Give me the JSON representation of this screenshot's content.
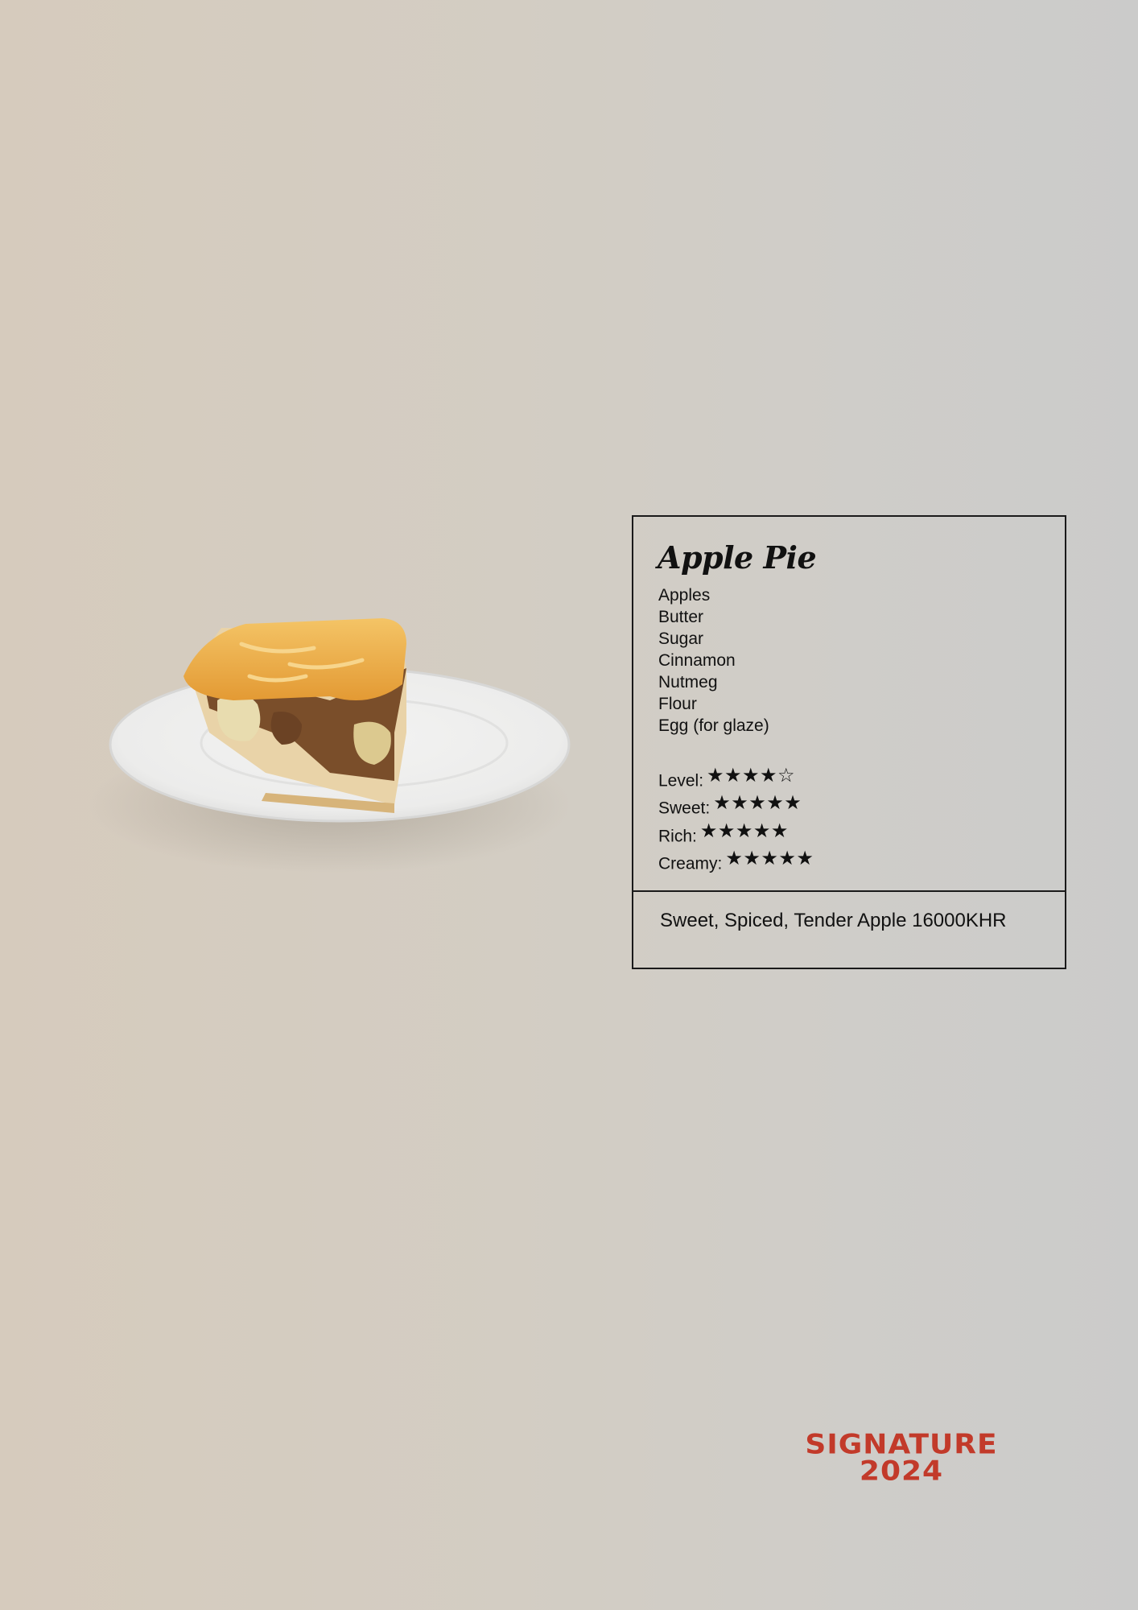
{
  "item": {
    "name": "Apple Pie",
    "ingredients": [
      "Apples",
      "Butter",
      "Sugar",
      "Cinnamon",
      "Nutmeg",
      "Flour",
      "Egg (for glaze)"
    ],
    "ratings": [
      {
        "label": "Level:",
        "stars": 4,
        "max": 5
      },
      {
        "label": "Sweet:",
        "stars": 5,
        "max": 5
      },
      {
        "label": "Rich:",
        "stars": 5,
        "max": 5
      },
      {
        "label": "Creamy:",
        "stars": 5,
        "max": 5
      }
    ],
    "tagline": "Sweet, Spiced, Tender Apple 16000KHR"
  },
  "image": {
    "subject": "pie-slice-on-plate-icon"
  },
  "logo": {
    "line1": "SIGNATURE",
    "line2": "2024",
    "color": "#c23a2a"
  },
  "colors": {
    "border": "#1a1a1a",
    "text": "#111111"
  }
}
